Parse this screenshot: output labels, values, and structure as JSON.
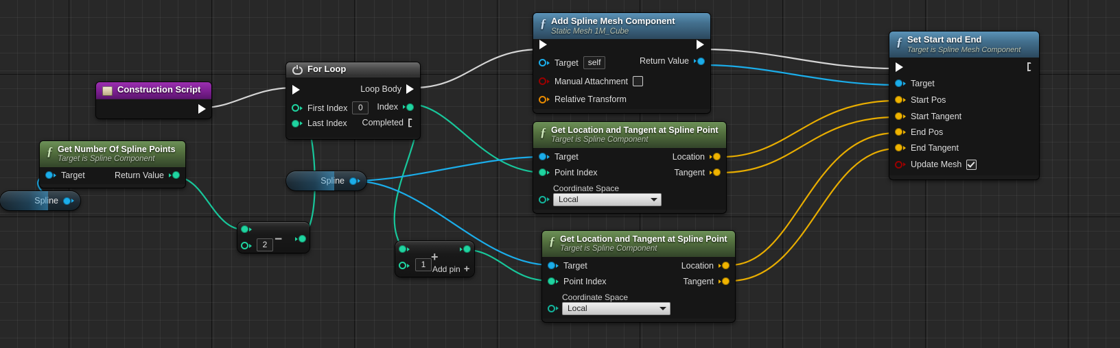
{
  "app": {
    "name": "Unreal Engine Blueprint Editor",
    "graph": "Construction Script"
  },
  "colors": {
    "exec_white": "#ffffff",
    "object_blue": "#1badea",
    "int_green": "#1fd4a0",
    "vector_yellow": "#efb300",
    "bool_red": "#9a0000",
    "enum_teal": "#13b49c",
    "header_blue": "#44718f",
    "header_green": "#54713f",
    "header_purple": "#7c1f91",
    "header_grey": "#4a4a4a"
  },
  "nodes": {
    "construction_script": {
      "title": "Construction Script",
      "icon": "blueprint-event-icon",
      "out_exec": "exec-out"
    },
    "get_number_of_spline_points": {
      "title": "Get Number Of Spline Points",
      "subtitle": "Target is Spline Component",
      "icon": "function-f-icon",
      "inputs": [
        {
          "label": "Target",
          "type": "object"
        }
      ],
      "outputs": [
        {
          "label": "Return Value",
          "type": "int"
        }
      ]
    },
    "spline_var_left": {
      "label": "Spline",
      "type": "object"
    },
    "spline_var_mid": {
      "label": "Spline",
      "type": "object"
    },
    "for_loop": {
      "title": "For Loop",
      "icon": "macro-loop-icon",
      "inputs": [
        {
          "label": "First Index",
          "value": "0",
          "type": "int"
        },
        {
          "label": "Last Index",
          "type": "int"
        }
      ],
      "outputs": [
        {
          "label": "Loop Body",
          "type": "exec"
        },
        {
          "label": "Index",
          "type": "int"
        },
        {
          "label": "Completed",
          "type": "exec"
        }
      ]
    },
    "subtract_node": {
      "operator": "−",
      "value": "2",
      "type": "int"
    },
    "add_node": {
      "operator": "+",
      "value": "1",
      "add_pin_label": "Add pin",
      "type": "int"
    },
    "add_spline_mesh_component": {
      "title": "Add Spline Mesh Component",
      "subtitle": "Static Mesh 1M_Cube",
      "icon": "function-f-icon",
      "inputs": [
        {
          "label": "Target",
          "value": "self",
          "type": "object"
        },
        {
          "label": "Manual Attachment",
          "value": false,
          "type": "bool"
        },
        {
          "label": "Relative Transform",
          "type": "struct"
        }
      ],
      "outputs": [
        {
          "label": "Return Value",
          "type": "object"
        }
      ]
    },
    "get_loc_tangent_1": {
      "title": "Get Location and Tangent at Spline Point",
      "subtitle": "Target is Spline Component",
      "icon": "function-f-icon",
      "inputs": [
        {
          "label": "Target",
          "type": "object"
        },
        {
          "label": "Point Index",
          "type": "int"
        }
      ],
      "coordinate_space": {
        "label": "Coordinate Space",
        "value": "Local"
      },
      "outputs": [
        {
          "label": "Location",
          "type": "vector"
        },
        {
          "label": "Tangent",
          "type": "vector"
        }
      ]
    },
    "get_loc_tangent_2": {
      "title": "Get Location and Tangent at Spline Point",
      "subtitle": "Target is Spline Component",
      "icon": "function-f-icon",
      "inputs": [
        {
          "label": "Target",
          "type": "object"
        },
        {
          "label": "Point Index",
          "type": "int"
        }
      ],
      "coordinate_space": {
        "label": "Coordinate Space",
        "value": "Local"
      },
      "outputs": [
        {
          "label": "Location",
          "type": "vector"
        },
        {
          "label": "Tangent",
          "type": "vector"
        }
      ]
    },
    "set_start_and_end": {
      "title": "Set Start and End",
      "subtitle": "Target is Spline Mesh Component",
      "icon": "function-f-icon",
      "inputs": [
        {
          "label": "Target",
          "type": "object"
        },
        {
          "label": "Start Pos",
          "type": "vector"
        },
        {
          "label": "Start Tangent",
          "type": "vector"
        },
        {
          "label": "End Pos",
          "type": "vector"
        },
        {
          "label": "End Tangent",
          "type": "vector"
        },
        {
          "label": "Update Mesh",
          "value": true,
          "type": "bool"
        }
      ]
    }
  }
}
